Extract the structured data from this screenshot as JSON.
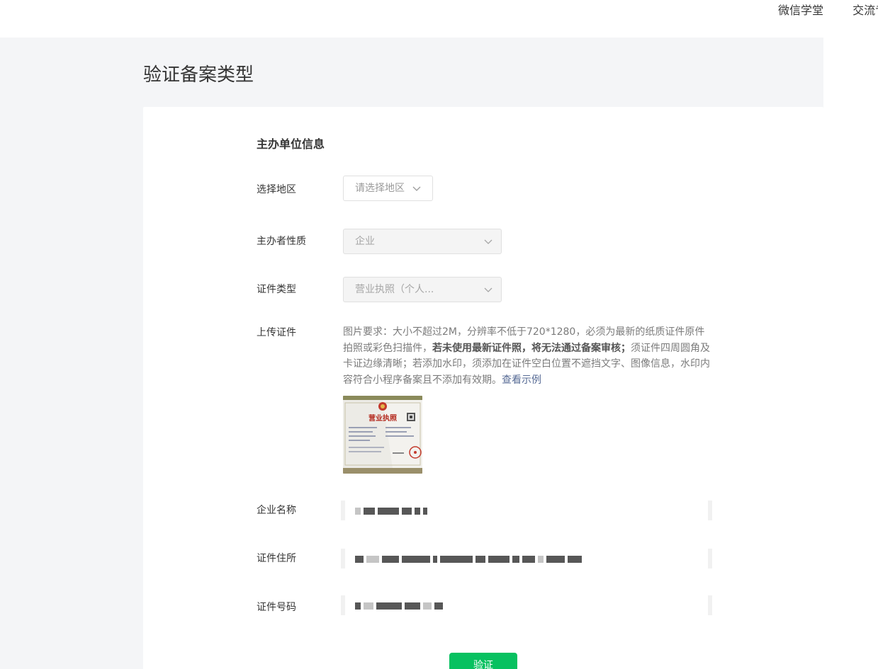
{
  "topnav": {
    "items": [
      "微信学堂",
      "交流专"
    ]
  },
  "page": {
    "title": "验证备案类型"
  },
  "section": {
    "title": "主办单位信息"
  },
  "form": {
    "region": {
      "label": "选择地区",
      "placeholder": "请选择地区"
    },
    "owner_type": {
      "label": "主办者性质",
      "value": "企业"
    },
    "cert_type": {
      "label": "证件类型",
      "value": "营业执照（个人..."
    },
    "upload": {
      "label": "上传证件",
      "tip_part1": "图片要求：大小不超过2M，分辨率不低于720*1280，必须为最新的纸质证件原件拍照或彩色扫描件，",
      "tip_bold": "若未使用最新证件照，将无法通过备案审核；",
      "tip_part2": "须证件四周圆角及卡证边缘清晰；若添加水印，须添加在证件空白位置不遮挡文字、图像信息，水印内容符合小程序备案且不添加有效期。",
      "example_link": "查看示例",
      "thumbnail_text": "营业执照"
    },
    "company_name": {
      "label": "企业名称"
    },
    "cert_address": {
      "label": "证件住所"
    },
    "cert_number": {
      "label": "证件号码"
    },
    "submit_label": "验证"
  },
  "colors": {
    "primary": "#07c160",
    "link": "#576b95",
    "page_bg": "#f4f5f7",
    "card_bg": "#ffffff"
  }
}
